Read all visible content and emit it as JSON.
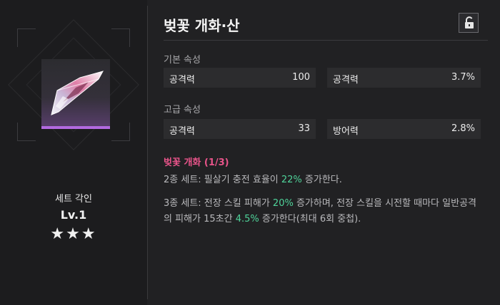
{
  "item": {
    "title": "벚꽃 개화·산",
    "rarity_color": "#b36ae0",
    "icon_name": "blade-shard-icon"
  },
  "left_panel": {
    "set_label": "세트 각인",
    "level": "Lv.1",
    "stars": "★★★",
    "star_count": 3
  },
  "lock": {
    "icon": "unlock-icon"
  },
  "basic_stats": {
    "label": "기본 속성",
    "items": [
      {
        "name": "공격력",
        "value": "100"
      },
      {
        "name": "공격력",
        "value": "3.7%"
      }
    ]
  },
  "advanced_stats": {
    "label": "고급 속성",
    "items": [
      {
        "name": "공격력",
        "value": "33"
      },
      {
        "name": "방어력",
        "value": "2.8%"
      }
    ]
  },
  "set_effect": {
    "name": "벚꽃 개화 (1/3)",
    "effects": [
      {
        "prefix": "2종 세트: 필살기 충전 효율이 ",
        "highlight": "22%",
        "suffix": " 증가한다."
      },
      {
        "prefix": "3종 세트: 전장 스킬 피해가 ",
        "highlight": "20%",
        "mid": " 증가하며, 전장 스킬을 시전할 때마다 일반공격의 피해가 15초간 ",
        "highlight2": "4.5%",
        "suffix": " 증가한다(최대 6회 중첩)."
      }
    ]
  },
  "colors": {
    "background": "#212123",
    "accent_pink": "#e8548a",
    "accent_green": "#4fd39a"
  }
}
